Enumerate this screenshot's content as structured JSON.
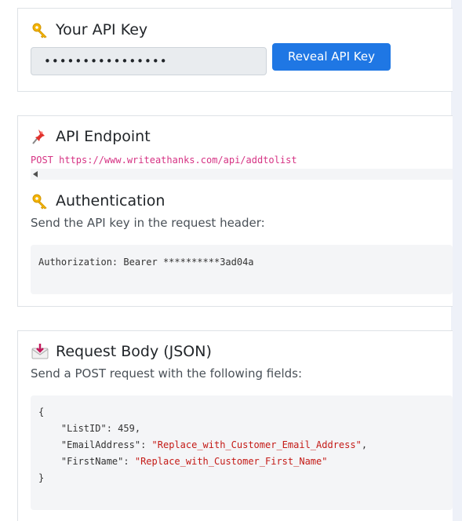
{
  "api_key_card": {
    "icon": "key-icon",
    "title": "Your API Key",
    "masked_key": "••••••••••••••••",
    "reveal_button_label": "Reveal API Key"
  },
  "endpoint_card": {
    "endpoint_icon": "pushpin-icon",
    "endpoint_title": "API Endpoint",
    "endpoint_line": "POST https://www.writeathanks.com/api/addtolist",
    "auth_icon": "key-icon",
    "auth_title": "Authentication",
    "auth_desc": "Send the API key in the request header:",
    "auth_header": "Authorization: Bearer **********3ad04a"
  },
  "request_card": {
    "icon": "envelope-arrow-icon",
    "title": "Request Body (JSON)",
    "desc": "Send a POST request with the following fields:",
    "open_brace": "{",
    "close_brace": "}",
    "fields": [
      {
        "key": "\"ListID\"",
        "value": "459",
        "is_string": false
      },
      {
        "key": "\"EmailAddress\"",
        "value": "\"Replace_with_Customer_Email_Address\"",
        "is_string": true
      },
      {
        "key": "\"FirstName\"",
        "value": "\"Replace_with_Customer_First_Name\"",
        "is_string": true
      }
    ]
  },
  "colors": {
    "button_blue": "#1f77e4",
    "endpoint_pink": "#d63384",
    "json_string_red": "#c41a16",
    "page_strip": "#eef1f8"
  }
}
